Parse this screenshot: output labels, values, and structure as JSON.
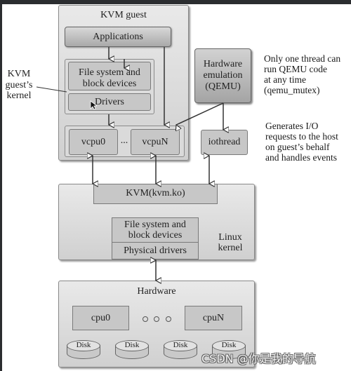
{
  "diagram": {
    "kvm_guest": {
      "title": "KVM guest",
      "applications": "Applications",
      "kernel": {
        "file_system": "File system and block devices",
        "file_system_line1": "File system and",
        "file_system_line2": "block devices",
        "drivers": "Drivers"
      },
      "vcpus": {
        "first": "vcpu0",
        "ellipsis": "...",
        "last": "vcpuN"
      }
    },
    "kernel_annotation": {
      "line1": "KVM",
      "line2": "guest’s",
      "line3": "kernel"
    },
    "qemu": {
      "line1": "Hardware",
      "line2": "emulation",
      "line3": "(QEMU)"
    },
    "qemu_note": {
      "line1": "Only one thread can",
      "line2": "run QEMU code",
      "line3": "at any time",
      "line4": "(qemu_mutex)"
    },
    "iothread": {
      "label": "iothread"
    },
    "iothread_note": {
      "line1": "Generates I/O",
      "line2": "requests to the host",
      "line3": "on guest’s behalf",
      "line4": "and handles events"
    },
    "linux_kernel": {
      "kvm_module": "KVM(kvm.ko)",
      "file_system_line1": "File system and",
      "file_system_line2": "block devices",
      "physical_drivers": "Physical drivers",
      "label_line1": "Linux",
      "label_line2": "kernel"
    },
    "hardware": {
      "title": "Hardware",
      "cpu_first": "cpu0",
      "cpu_last": "cpuN",
      "disks": [
        "Disk",
        "Disk",
        "Disk",
        "Disk"
      ]
    }
  },
  "watermark": "CSDN @你是我的导航",
  "cursor": "arrow-cursor"
}
